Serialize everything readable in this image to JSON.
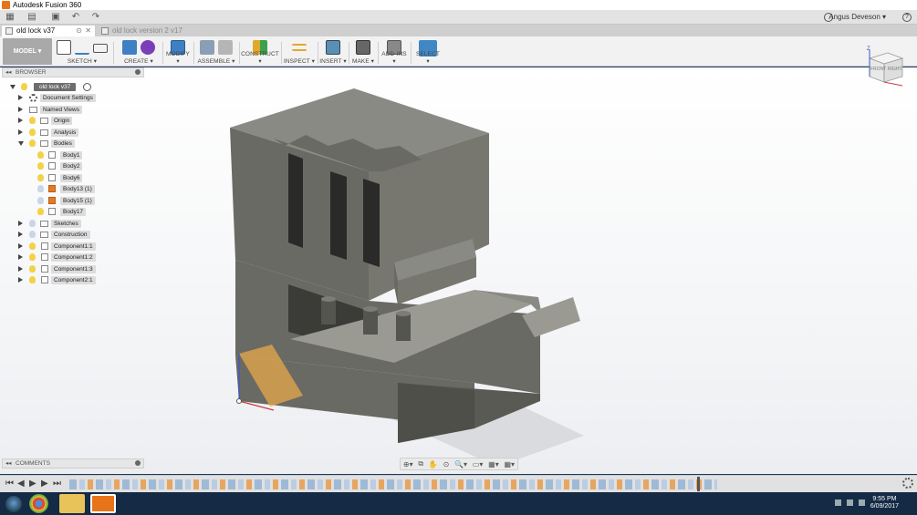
{
  "window": {
    "title": "Autodesk Fusion 360"
  },
  "quick_access": {
    "user_name": "Angus Deveson ▾",
    "help_glyph": "?"
  },
  "tabs": [
    {
      "label": "old lock v37",
      "active": true
    },
    {
      "label": "old lock version 2 v17",
      "active": false
    }
  ],
  "ribbon": {
    "mode": "MODEL ▾",
    "groups": [
      {
        "label": "SKETCH ▾"
      },
      {
        "label": "CREATE ▾"
      },
      {
        "label": "MODIFY ▾"
      },
      {
        "label": "ASSEMBLE ▾"
      },
      {
        "label": "CONSTRUCT ▾"
      },
      {
        "label": "INSPECT ▾"
      },
      {
        "label": "INSERT ▾"
      },
      {
        "label": "MAKE ▾"
      },
      {
        "label": "ADD-INS ▾"
      },
      {
        "label": "SELECT ▾"
      }
    ],
    "colors": {
      "create_solid": "#3f7fc4",
      "modify": "#7a3fb8",
      "construct": "#3da04a",
      "inspect": "#e0a92e",
      "select": "#3f88c5"
    }
  },
  "browser": {
    "title": "BROWSER",
    "root": "old lock v37",
    "items": [
      {
        "label": "Document Settings"
      },
      {
        "label": "Named Views"
      },
      {
        "label": "Origin"
      },
      {
        "label": "Analysis"
      },
      {
        "label": "Bodies"
      },
      {
        "label": "Body1"
      },
      {
        "label": "Body2"
      },
      {
        "label": "Body6"
      },
      {
        "label": "Body13 (1)"
      },
      {
        "label": "Body15 (1)"
      },
      {
        "label": "Body17"
      },
      {
        "label": "Sketches"
      },
      {
        "label": "Construction"
      },
      {
        "label": "Component1:1"
      },
      {
        "label": "Component1:2"
      },
      {
        "label": "Component1:3"
      },
      {
        "label": "Component2:1"
      }
    ]
  },
  "comments": {
    "title": "COMMENTS"
  },
  "viewcube": {
    "front": "FRONT",
    "right": "RIGHT",
    "axis_z": "Z"
  },
  "navbar": {
    "items": [
      "⊕▾",
      "⧉",
      "✋",
      "⊙",
      "🔍▾",
      "▭▾",
      "▦▾",
      "▦▾"
    ]
  },
  "timeline": {
    "controls": [
      "⏮",
      "◀",
      "▶",
      "▶",
      "⏭"
    ]
  },
  "taskbar": {
    "time": "9:55 PM",
    "date": "6/09/2017",
    "apps": [
      {
        "name": "chrome",
        "color": "#e9b23a"
      },
      {
        "name": "explorer",
        "color": "#e8c35a"
      },
      {
        "name": "fusion360",
        "color": "#e8741a"
      }
    ]
  }
}
